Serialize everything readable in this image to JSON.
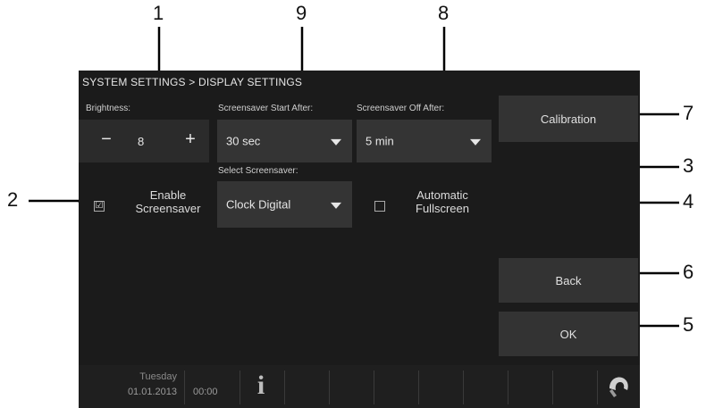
{
  "callouts": [
    "1",
    "9",
    "8",
    "7",
    "2",
    "3",
    "4",
    "6",
    "5"
  ],
  "breadcrumb": "SYSTEM SETTINGS > DISPLAY SETTINGS",
  "brightness": {
    "label": "Brightness:",
    "minus": "−",
    "value": "8",
    "plus": "+"
  },
  "screensaver_start": {
    "label": "Screensaver Start After:",
    "value": "30 sec"
  },
  "screensaver_off": {
    "label": "Screensaver Off After:",
    "value": "5 min"
  },
  "calibration_label": "Calibration",
  "select_screensaver": {
    "label": "Select Screensaver:",
    "value": "Clock Digital"
  },
  "enable_screensaver": {
    "label_line1": "Enable",
    "label_line2": "Screensaver",
    "checked_mark": "☑"
  },
  "automatic_fullscreen": {
    "label_line1": "Automatic",
    "label_line2": "Fullscreen"
  },
  "back_label": "Back",
  "ok_label": "OK",
  "statusbar": {
    "day": "Tuesday",
    "date": "01.01.2013",
    "time": "00:00",
    "info_glyph": "i"
  },
  "colors": {
    "screen_bg": "#1b1b1b",
    "button_bg": "#333333",
    "text": "#dcdcdc"
  }
}
